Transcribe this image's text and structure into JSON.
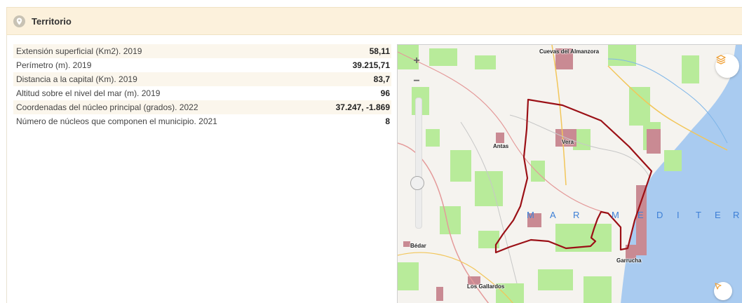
{
  "panel": {
    "title": "Territorio",
    "icon": "location-pin-icon"
  },
  "stats": [
    {
      "label": "Extensión superficial (Km2). 2019",
      "value": "58,11"
    },
    {
      "label": "Perímetro (m). 2019",
      "value": "39.215,71"
    },
    {
      "label": "Distancia a la capital (Km). 2019",
      "value": "83,7"
    },
    {
      "label": "Altitud sobre el nivel del mar (m). 2019",
      "value": "96"
    },
    {
      "label": "Coordenadas del núcleo principal (grados). 2022",
      "value": "37.247, -1.869"
    },
    {
      "label": "Número de núcleos que componen el municipio. 2021",
      "value": "8"
    }
  ],
  "map": {
    "zoom_in": "+",
    "zoom_out": "−",
    "zoom_level": 0.35,
    "places": {
      "cuevas": "Cuevas del Almanzora",
      "vera": "Vera",
      "antas": "Antas",
      "bedar": "Bédar",
      "garrucha": "Garrucha",
      "los_gallardos": "Los Gallardos"
    },
    "sea_letters": [
      "M",
      "A",
      "R",
      "M",
      "E",
      "D",
      "I",
      "T",
      "E",
      "R"
    ],
    "colors": {
      "sea": "#a9cbf0",
      "land": "#f5f3ef",
      "green": "#b8eb9a",
      "urban": "#c98a93",
      "boundary": "#9b1016",
      "accent": "#f0a23a"
    },
    "icons": [
      "layers-icon",
      "select-cursor-icon"
    ]
  }
}
